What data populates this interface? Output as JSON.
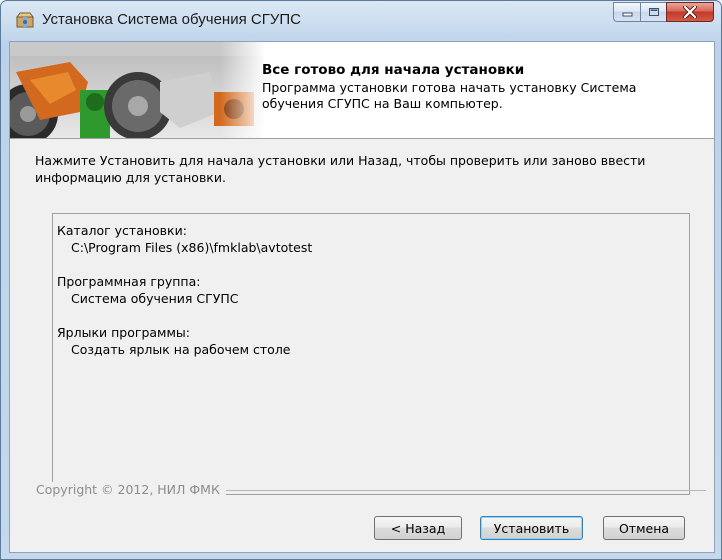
{
  "window": {
    "title": "Установка Система обучения СГУПС"
  },
  "header": {
    "title": "Все готово для начала установки",
    "description": "Программа установки готова начать установку Система обучения СГУПС на Ваш компьютер."
  },
  "intro": "Нажмите Установить для начала установки или Назад, чтобы проверить или заново ввести информацию для установки.",
  "summary": {
    "dir_label": "Каталог установки:",
    "dir_value": "C:\\Program Files (x86)\\fmklab\\avtotest",
    "group_label": "Программная группа:",
    "group_value": "Система обучения СГУПС",
    "shortcuts_label": "Ярлыки программы:",
    "shortcuts_value": "Создать ярлык на рабочем столе"
  },
  "footer": {
    "copyright": "Copyright © 2012, НИЛ ФМК"
  },
  "buttons": {
    "back": "< Назад",
    "install": "Установить",
    "cancel": "Отмена"
  },
  "colors": {
    "title_bar": "#c8dbee",
    "close_button": "#c2382a",
    "default_button_border": "#3c7fb1"
  },
  "icons": {
    "app": "installer-icon",
    "minimize": "minimize-icon",
    "maximize": "maximize-icon",
    "close": "close-icon"
  }
}
